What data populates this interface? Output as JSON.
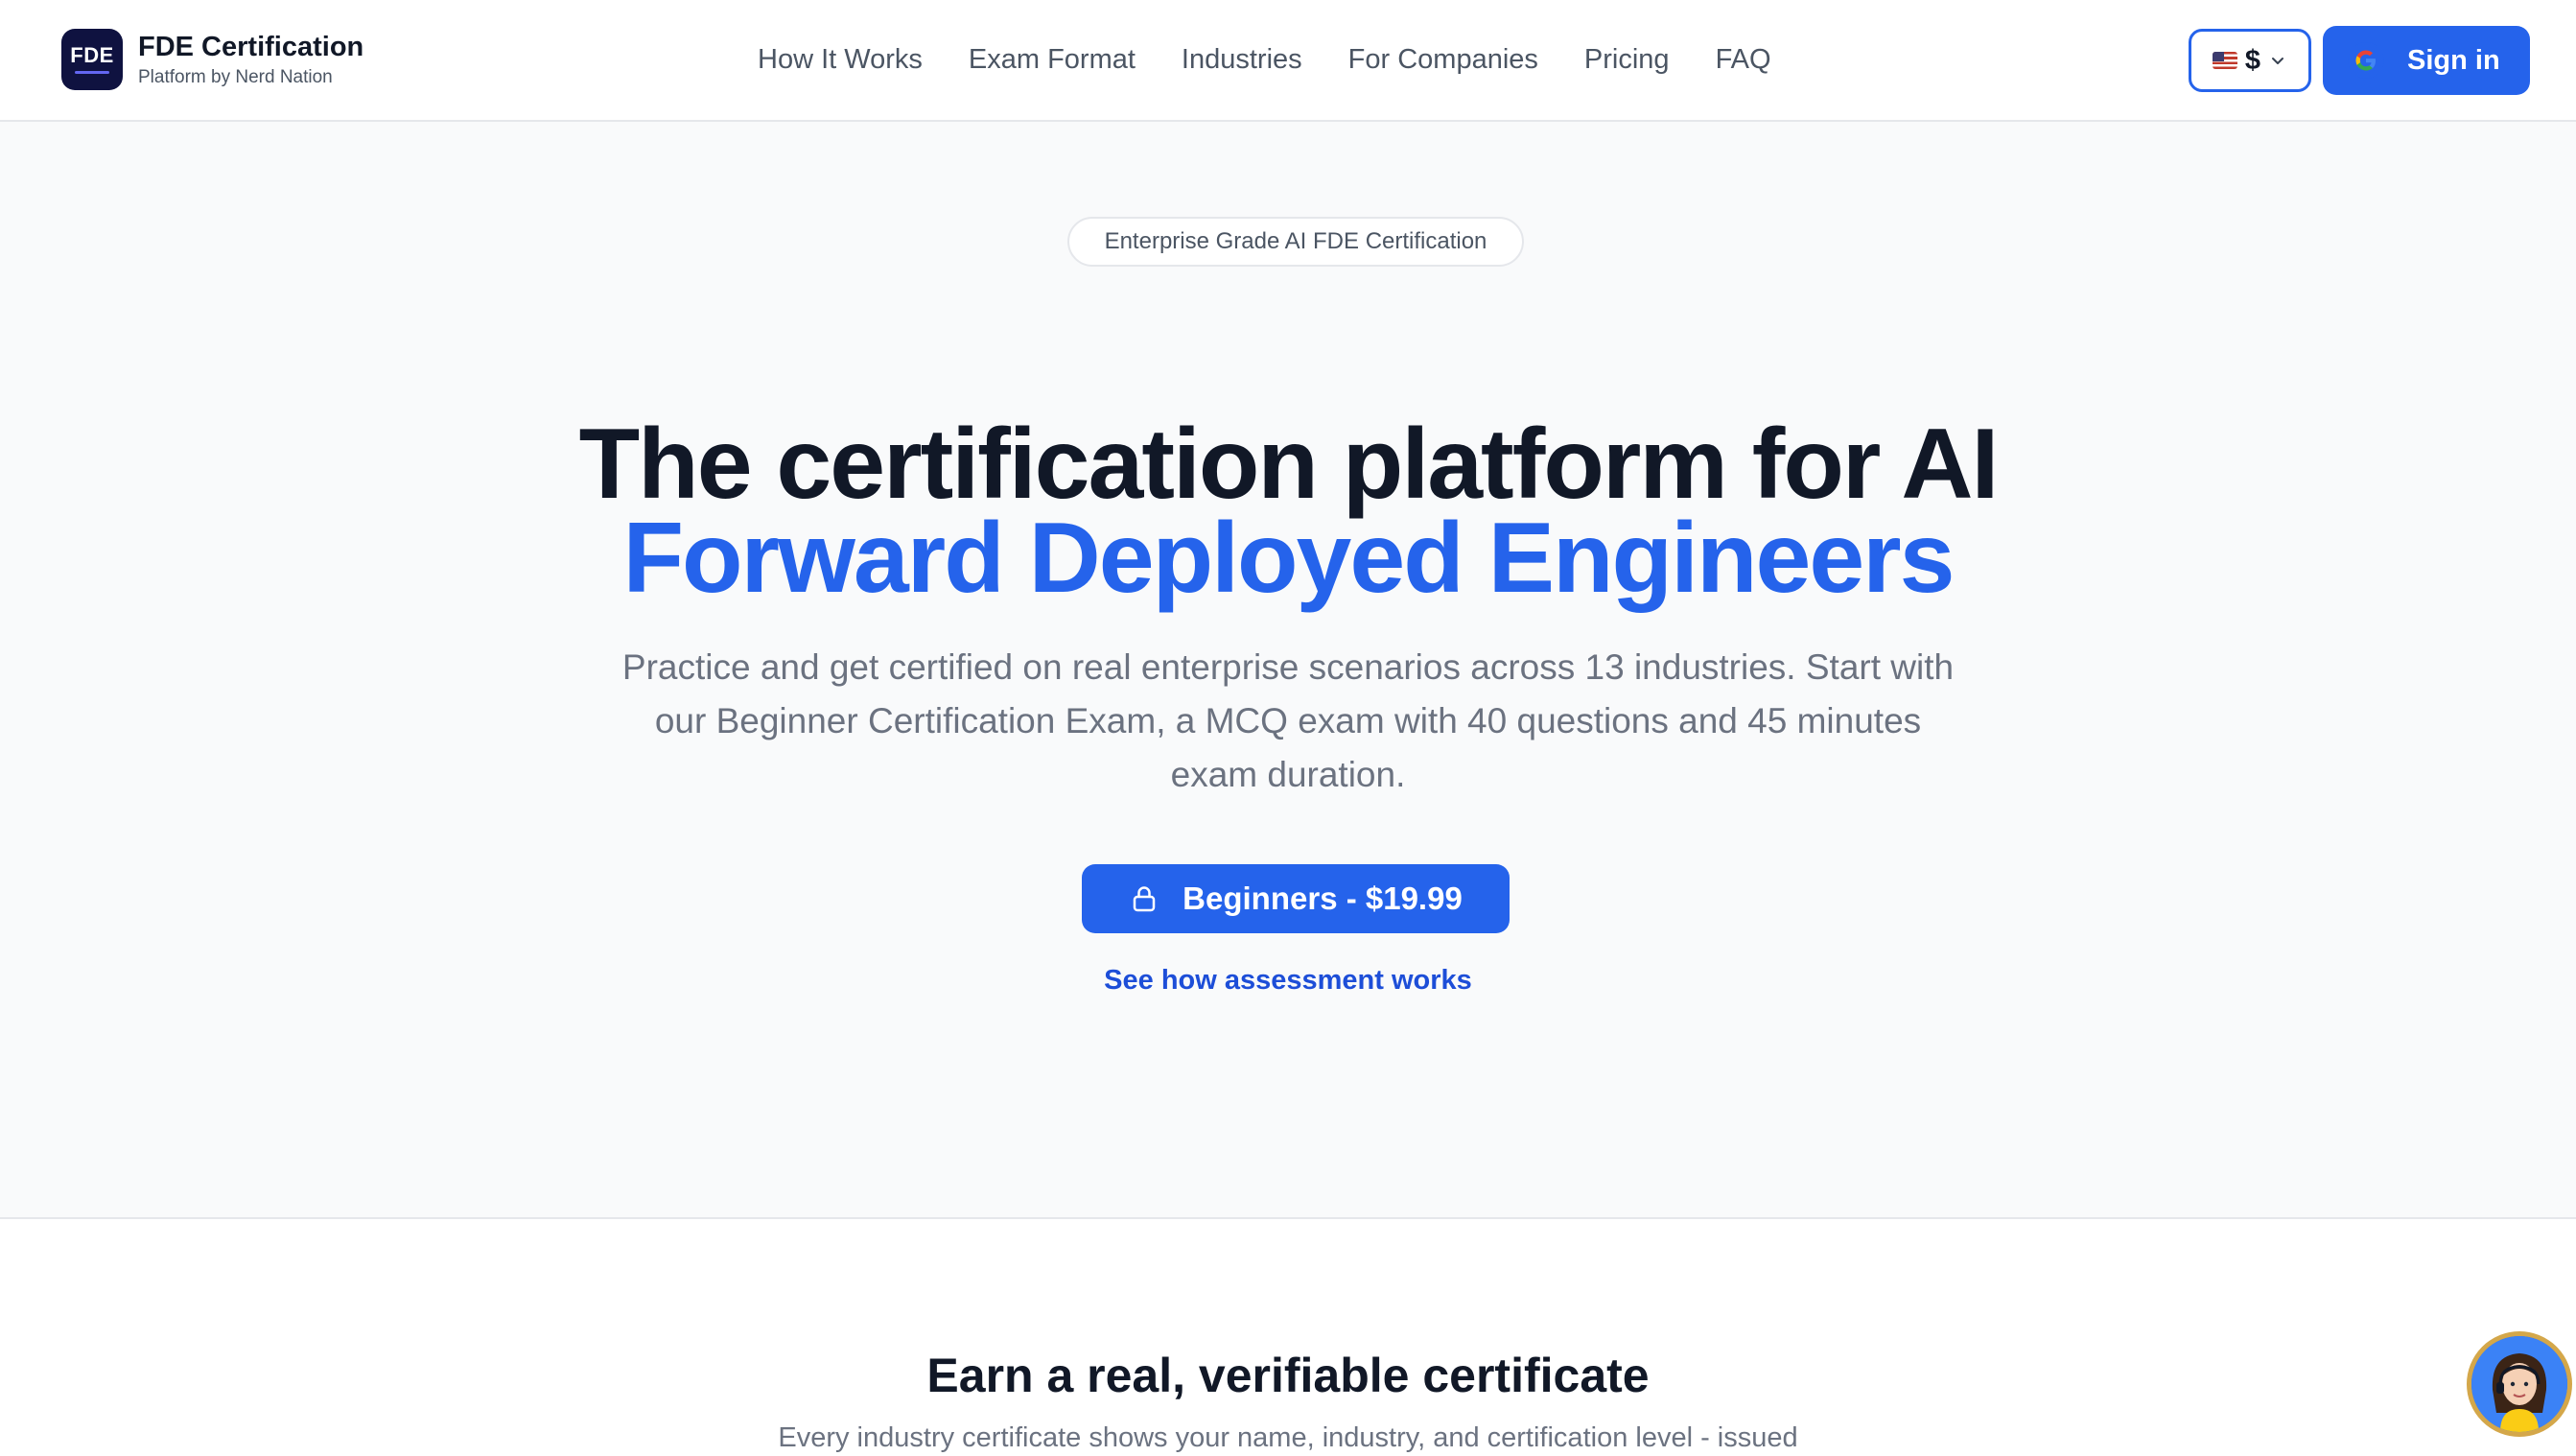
{
  "header": {
    "logo_text": "FDE",
    "brand_title": "FDE Certification",
    "brand_subtitle": "Platform by Nerd Nation",
    "nav": [
      "How It Works",
      "Exam Format",
      "Industries",
      "For Companies",
      "Pricing",
      "FAQ"
    ],
    "currency": {
      "flag_icon": "us-flag-icon",
      "symbol": "$"
    },
    "signin_label": "Sign in"
  },
  "hero": {
    "pill": "Enterprise Grade AI FDE Certification",
    "title_line1": "The certification platform for AI",
    "title_line2": "Forward Deployed Engineers",
    "description": "Practice and get certified on real enterprise scenarios across 13 industries. Start with our Beginner Certification Exam, a MCQ exam with 40 questions and 45 minutes exam duration.",
    "cta_label": "Beginners - $19.99",
    "secondary_link": "See how assessment works"
  },
  "certificate_section": {
    "title": "Earn a real, verifiable certificate",
    "subtitle": "Every industry certificate shows your name, industry, and certification level - issued"
  },
  "colors": {
    "accent": "#2563eb",
    "heading": "#111827",
    "muted": "#6b7280",
    "background": "#f9fafb",
    "logo_bg": "#0f1240"
  }
}
